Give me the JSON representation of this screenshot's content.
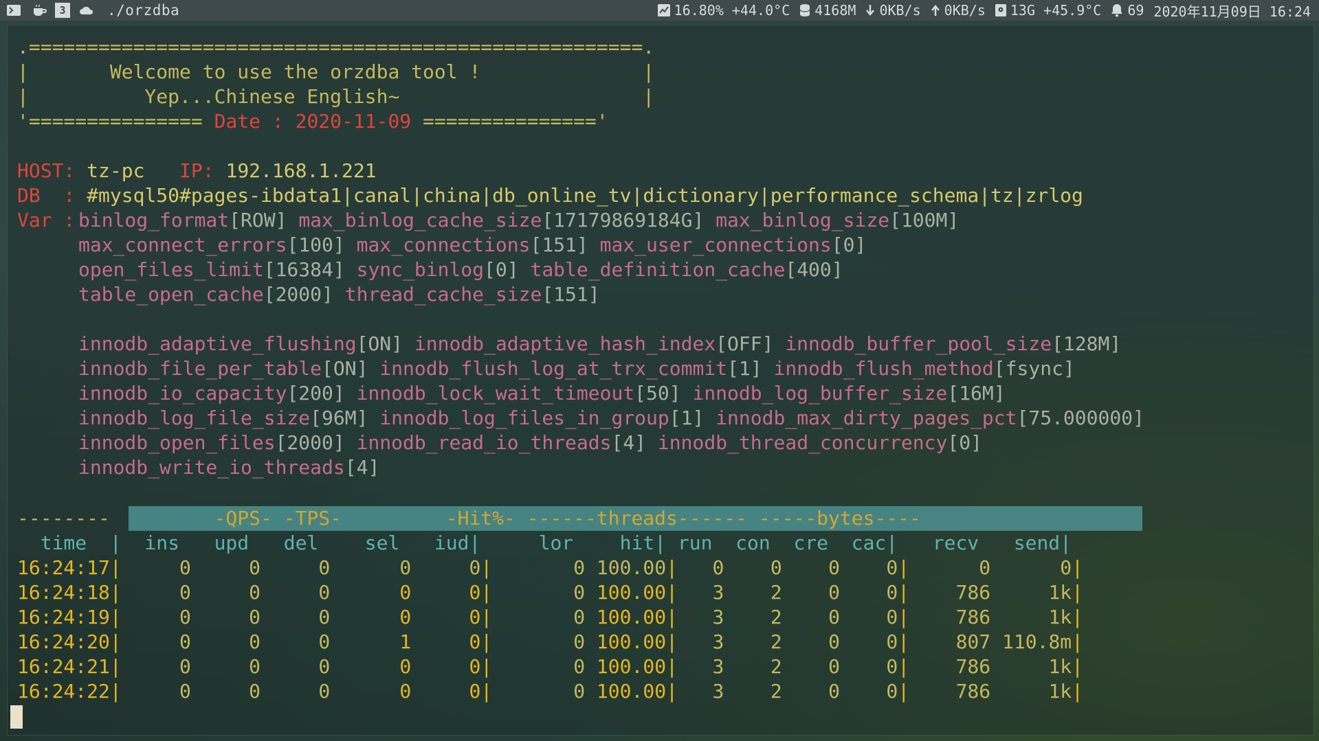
{
  "topbar": {
    "title": "./orzdba",
    "cpu": "16.80% +44.0°C",
    "mem": "4168M",
    "net_down": "0KB/s",
    "net_up": "0KB/s",
    "disk": "13G +45.9°C",
    "notify": "69",
    "datetime": "2020年11月09日 16:24",
    "workspace": "3"
  },
  "banner": {
    "top": ".=====================================================.",
    "l1_pre": "|       Welcome to use the orzdba tool !              |",
    "l2": "|          Yep...Chinese English~                     |",
    "l3_pre": "'=============== ",
    "date": "Date : 2020-11-09",
    "l3_post": " ==============='"
  },
  "host": {
    "host_label": "HOST:",
    "host_value": "tz-pc",
    "ip_label": "IP:",
    "ip_value": "192.168.1.221",
    "db_label": "DB  :",
    "db_value": "#mysql50#pages-ibdata1|canal|china|db_online_tv|dictionary|performance_schema|tz|zrlog",
    "var_label": "Var :"
  },
  "vars": [
    [
      [
        "binlog_format",
        "[ROW]"
      ],
      [
        "max_binlog_cache_size",
        "[17179869184G]"
      ],
      [
        "max_binlog_size",
        "[100M]"
      ]
    ],
    [
      [
        "max_connect_errors",
        "[100]"
      ],
      [
        "max_connections",
        "[151]"
      ],
      [
        "max_user_connections",
        "[0]"
      ]
    ],
    [
      [
        "open_files_limit",
        "[16384]"
      ],
      [
        "sync_binlog",
        "[0]"
      ],
      [
        "table_definition_cache",
        "[400]"
      ]
    ],
    [
      [
        "table_open_cache",
        "[2000]"
      ],
      [
        "thread_cache_size",
        "[151]"
      ]
    ]
  ],
  "innodb": [
    [
      [
        "innodb_adaptive_flushing",
        "[ON]"
      ],
      [
        "innodb_adaptive_hash_index",
        "[OFF]"
      ],
      [
        "innodb_buffer_pool_size",
        "[128M]"
      ]
    ],
    [
      [
        "innodb_file_per_table",
        "[ON]"
      ],
      [
        "innodb_flush_log_at_trx_commit",
        "[1]"
      ],
      [
        "innodb_flush_method",
        "[fsync]"
      ]
    ],
    [
      [
        "innodb_io_capacity",
        "[200]"
      ],
      [
        "innodb_lock_wait_timeout",
        "[50]"
      ],
      [
        "innodb_log_buffer_size",
        "[16M]"
      ]
    ],
    [
      [
        "innodb_log_file_size",
        "[96M]"
      ],
      [
        "innodb_log_files_in_group",
        "[1]"
      ],
      [
        "innodb_max_dirty_pages_pct",
        "[75.000000]"
      ]
    ],
    [
      [
        "innodb_open_files",
        "[2000]"
      ],
      [
        "innodb_read_io_threads",
        "[4]"
      ],
      [
        "innodb_thread_concurrency",
        "[0]"
      ]
    ],
    [
      [
        "innodb_write_io_threads",
        "[4]"
      ]
    ]
  ],
  "table": {
    "group_header_left": "--------",
    "group_header": "        -QPS- -TPS-         -Hit%- ------threads------ -----bytes----",
    "columns_line": "  time  |  ins   upd   del    sel   iud|     lor    hit| run  con  cre  cac|   recv   send|",
    "rows": [
      {
        "time": "16:24:17",
        "ins": "0",
        "upd": "0",
        "del": "0",
        "sel": "0",
        "iud": "0",
        "lor": "0",
        "hit": "100.00",
        "run": "0",
        "con": "0",
        "cre": "0",
        "cac": "0",
        "recv": "0",
        "send": "0"
      },
      {
        "time": "16:24:18",
        "ins": "0",
        "upd": "0",
        "del": "0",
        "sel": "0",
        "iud": "0",
        "lor": "0",
        "hit": "100.00",
        "run": "3",
        "con": "2",
        "cre": "0",
        "cac": "0",
        "recv": "786",
        "send": "1k"
      },
      {
        "time": "16:24:19",
        "ins": "0",
        "upd": "0",
        "del": "0",
        "sel": "0",
        "iud": "0",
        "lor": "0",
        "hit": "100.00",
        "run": "3",
        "con": "2",
        "cre": "0",
        "cac": "0",
        "recv": "786",
        "send": "1k"
      },
      {
        "time": "16:24:20",
        "ins": "0",
        "upd": "0",
        "del": "0",
        "sel": "1",
        "iud": "0",
        "lor": "0",
        "hit": "100.00",
        "run": "3",
        "con": "2",
        "cre": "0",
        "cac": "0",
        "recv": "807",
        "send": "110.8m"
      },
      {
        "time": "16:24:21",
        "ins": "0",
        "upd": "0",
        "del": "0",
        "sel": "0",
        "iud": "0",
        "lor": "0",
        "hit": "100.00",
        "run": "3",
        "con": "2",
        "cre": "0",
        "cac": "0",
        "recv": "786",
        "send": "1k"
      },
      {
        "time": "16:24:22",
        "ins": "0",
        "upd": "0",
        "del": "0",
        "sel": "0",
        "iud": "0",
        "lor": "0",
        "hit": "100.00",
        "run": "3",
        "con": "2",
        "cre": "0",
        "cac": "0",
        "recv": "786",
        "send": "1k"
      }
    ]
  }
}
